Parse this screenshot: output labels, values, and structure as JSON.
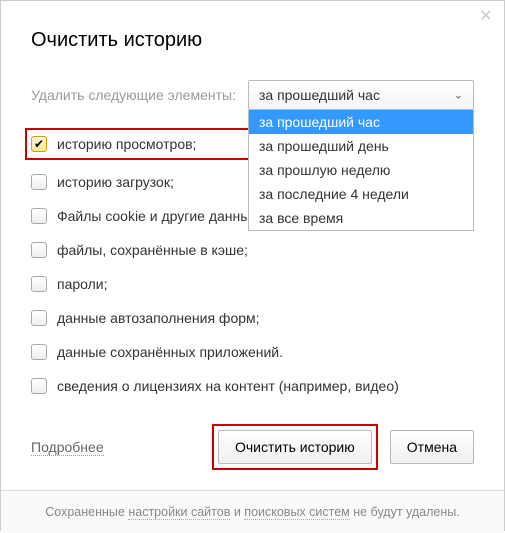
{
  "title": "Очистить историю",
  "delete_label": "Удалить следующие элементы:",
  "select": {
    "current": "за прошедший час",
    "options": [
      "за прошедший час",
      "за прошедший день",
      "за прошлую неделю",
      "за последние 4 недели",
      "за все время"
    ]
  },
  "checks": {
    "browsing": "историю просмотров;",
    "downloads": "историю загрузок;",
    "cookies": "Файлы cookie и другие данные сайтов и модулей",
    "cache": "файлы, сохранённые в кэше;",
    "passwords": "пароли;",
    "autofill": "данные автозаполнения форм;",
    "apps": "данные сохранённых приложений.",
    "licenses": "сведения о лицензиях на контент (например, видео)"
  },
  "more_link": "Подробнее",
  "buttons": {
    "clear": "Очистить историю",
    "cancel": "Отмена"
  },
  "footer": {
    "prefix": "Сохраненные ",
    "link1": "настройки сайтов",
    "mid": " и ",
    "link2": "поисковых систем",
    "suffix": " не будут удалены."
  }
}
